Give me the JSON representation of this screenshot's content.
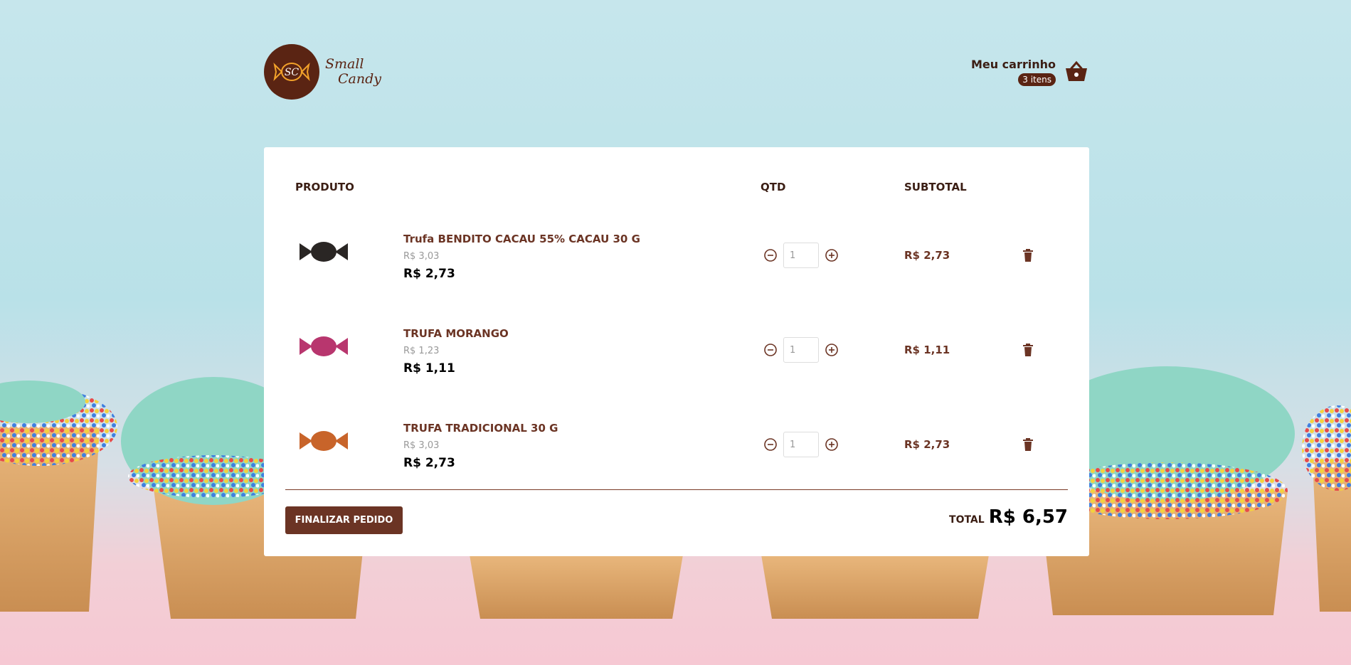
{
  "brand": {
    "logo_initials": "SC",
    "line1": "Small",
    "line2": "Candy"
  },
  "cart": {
    "title": "Meu carrinho",
    "count_label": "3 itens"
  },
  "table": {
    "headers": {
      "product": "PRODUTO",
      "qty": "QTD",
      "subtotal": "SUBTOTAL"
    },
    "items": [
      {
        "name": "Trufa BENDITO CACAU 55% CACAU 30 G",
        "old_price": "R$ 3,03",
        "price": "R$ 2,73",
        "qty": "1",
        "subtotal": "R$ 2,73",
        "wrapper_color": "#2a2624"
      },
      {
        "name": "TRUFA MORANGO",
        "old_price": "R$ 1,23",
        "price": "R$ 1,11",
        "qty": "1",
        "subtotal": "R$ 1,11",
        "wrapper_color": "#b8366e"
      },
      {
        "name": "TRUFA TRADICIONAL 30 G",
        "old_price": "R$ 3,03",
        "price": "R$ 2,73",
        "qty": "1",
        "subtotal": "R$ 2,73",
        "wrapper_color": "#c8642a"
      }
    ]
  },
  "footer": {
    "finish_label": "FINALIZAR PEDIDO",
    "total_label": "TOTAL",
    "total_value": "R$ 6,57"
  },
  "colors": {
    "brand_brown": "#6b3424",
    "dark_brown": "#5a2413"
  }
}
